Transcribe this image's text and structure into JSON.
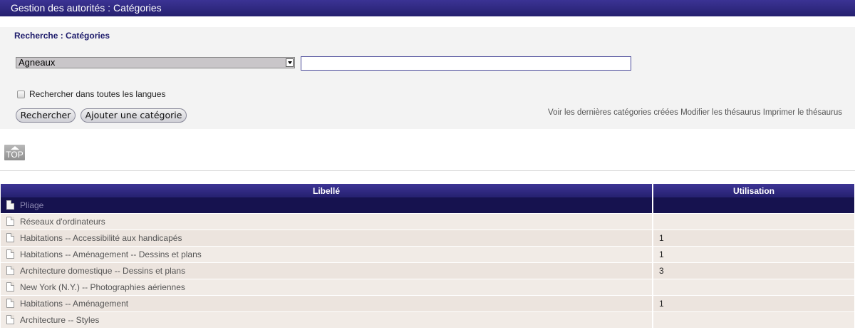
{
  "header": {
    "title": "Gestion des autorités : Catégories"
  },
  "search": {
    "title": "Recherche : Catégories",
    "thesaurus_selected": "Agneaux",
    "input_value": "",
    "all_languages_label": "Rechercher dans toutes les langues",
    "all_languages_checked": false,
    "search_button": "Rechercher",
    "add_button": "Ajouter une catégorie",
    "links": {
      "recent": "Voir les dernières catégories créées",
      "modify": "Modifier les thésaurus",
      "print": "Imprimer le thésaurus"
    }
  },
  "top_link": {
    "label": "TOP"
  },
  "table": {
    "columns": [
      "Libellé",
      "Utilisation"
    ],
    "rows": [
      {
        "label": "Pliage",
        "usage": "",
        "selected": true
      },
      {
        "label": "Réseaux d'ordinateurs",
        "usage": ""
      },
      {
        "label": "Habitations -- Accessibilité aux handicapés",
        "usage": "1"
      },
      {
        "label": "Habitations -- Aménagement -- Dessins et plans",
        "usage": "1"
      },
      {
        "label": "Architecture domestique -- Dessins et plans",
        "usage": "3"
      },
      {
        "label": "New York (N.Y.) -- Photographies aériennes",
        "usage": ""
      },
      {
        "label": "Habitations -- Aménagement",
        "usage": "1"
      },
      {
        "label": "Architecture -- Styles",
        "usage": ""
      }
    ]
  },
  "colors": {
    "header_bg": "#2c2680",
    "selected_row_bg": "#16124f",
    "row_bg": "#f1ebe6"
  }
}
